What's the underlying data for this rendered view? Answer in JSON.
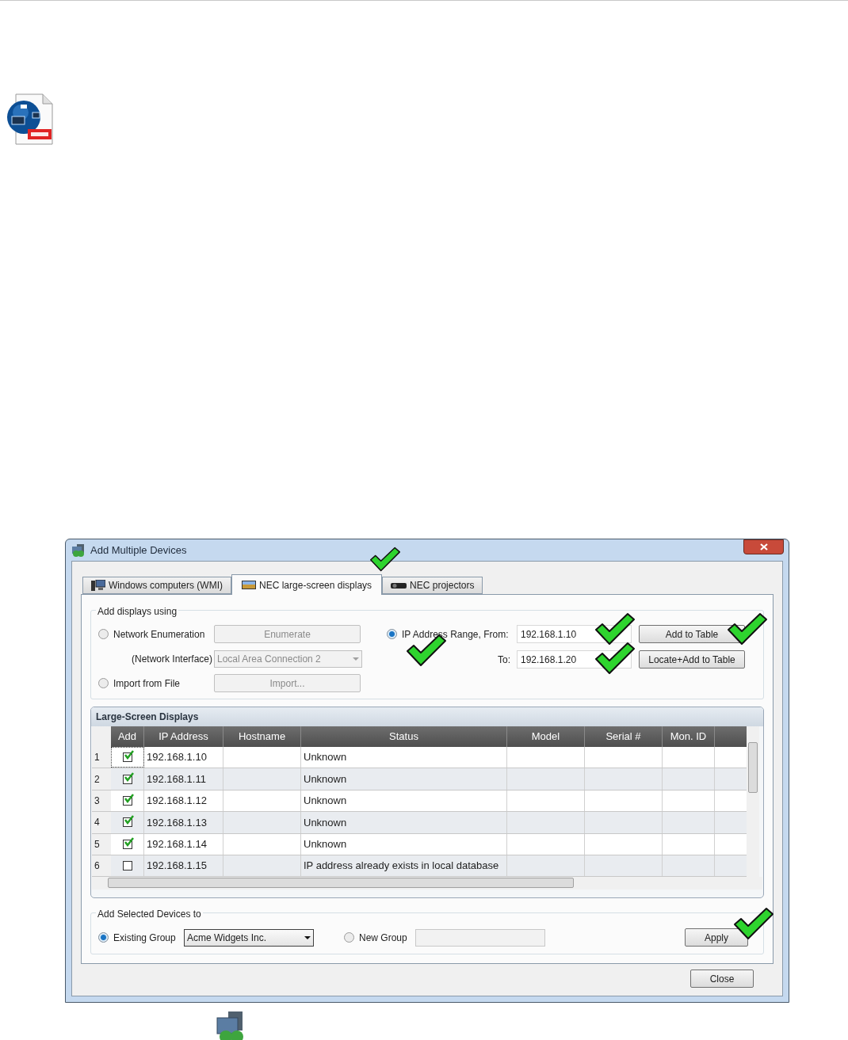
{
  "window": {
    "title": "Add Multiple Devices"
  },
  "tabs": [
    {
      "label": "Windows computers (WMI)",
      "selected": false
    },
    {
      "label": "NEC large-screen displays",
      "selected": true
    },
    {
      "label": "NEC projectors",
      "selected": false
    }
  ],
  "add_using": {
    "title": "Add displays using",
    "options": [
      {
        "label": "Network Enumeration",
        "selected": false,
        "button": "Enumerate"
      },
      {
        "label": "Import from File",
        "selected": false,
        "button": "Import..."
      },
      {
        "label": "IP Address Range, From:",
        "selected": true
      }
    ],
    "interface_label": "(Network Interface)",
    "interface_value": "Local Area Connection 2",
    "from_value": "192.168.1.10",
    "to_label": "To:",
    "to_value": "192.168.1.20",
    "add_button": "Add to Table",
    "locate_button": "Locate+Add to Table"
  },
  "table": {
    "title": "Large-Screen Displays",
    "columns": [
      "Add",
      "IP Address",
      "Hostname",
      "Status",
      "Model",
      "Serial #",
      "Mon. ID"
    ],
    "rows": [
      {
        "number": "1",
        "checked": true,
        "focused": true,
        "ip": "192.168.1.10",
        "status": "Unknown"
      },
      {
        "number": "2",
        "checked": true,
        "focused": false,
        "ip": "192.168.1.11",
        "status": "Unknown"
      },
      {
        "number": "3",
        "checked": true,
        "focused": false,
        "ip": "192.168.1.12",
        "status": "Unknown"
      },
      {
        "number": "4",
        "checked": true,
        "focused": false,
        "ip": "192.168.1.13",
        "status": "Unknown"
      },
      {
        "number": "5",
        "checked": true,
        "focused": false,
        "ip": "192.168.1.14",
        "status": "Unknown"
      },
      {
        "number": "6",
        "checked": false,
        "focused": false,
        "ip": "192.168.1.15",
        "status": "IP address already exists in local database"
      }
    ]
  },
  "add_to": {
    "title": "Add Selected Devices to",
    "options": [
      {
        "label": "Existing Group",
        "selected": true
      },
      {
        "label": "New Group",
        "selected": false
      }
    ],
    "group_value": "Acme Widgets Inc.",
    "apply_button": "Apply"
  },
  "close_button": "Close"
}
